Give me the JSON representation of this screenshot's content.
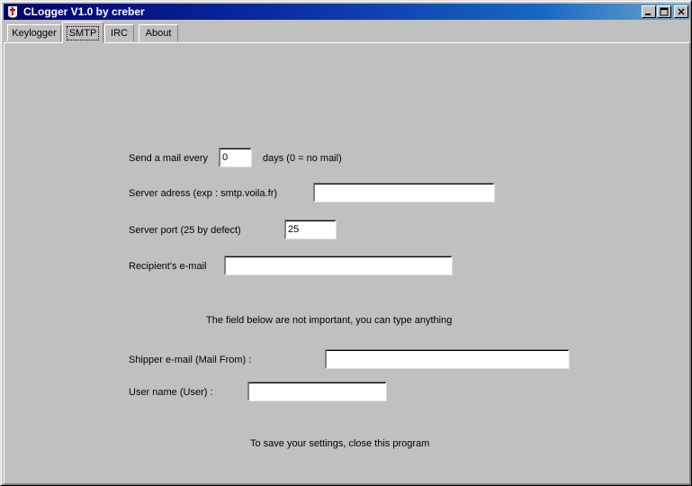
{
  "window": {
    "title": "CLogger V1.0 by creber",
    "icon": "shield-app-icon",
    "controls": {
      "minimize": "_",
      "maximize": "□",
      "close": "✕"
    },
    "colors": {
      "face": "#c0c0c0",
      "title_start": "#00006e",
      "title_end": "#6fa8cf",
      "text": "#000000",
      "field_bg": "#ffffff"
    }
  },
  "tabs": [
    {
      "label": "Keylogger",
      "active": false
    },
    {
      "label": "SMTP",
      "active": true
    },
    {
      "label": "IRC",
      "active": false
    },
    {
      "label": "About",
      "active": false
    }
  ],
  "smtp": {
    "interval": {
      "label": "Send a mail every",
      "value": "0",
      "suffix": "days (0 = no mail)",
      "placeholder": ""
    },
    "server_address": {
      "label": "Server adress (exp : smtp.voila.fr)",
      "value": "",
      "placeholder": ""
    },
    "server_port": {
      "label": "Server port  (25 by defect)",
      "value": "25",
      "placeholder": ""
    },
    "recipient": {
      "label": "Recipient's e-mail",
      "value": "",
      "placeholder": ""
    },
    "note_optional": "The field below are not important,  you can  type anything",
    "shipper": {
      "label": "Shipper e-mail (Mail From) :",
      "value": "",
      "placeholder": ""
    },
    "username": {
      "label": "User name (User) :",
      "value": "",
      "placeholder": ""
    },
    "note_save": "To save your settings, close this program"
  }
}
